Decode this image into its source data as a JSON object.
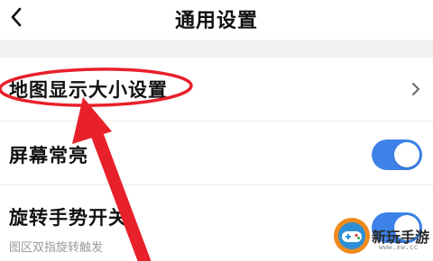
{
  "header": {
    "title": "通用设置",
    "back_icon": "chevron-left-icon"
  },
  "settings": [
    {
      "label": "地图显示大小设置",
      "type": "link",
      "icon": "chevron-right-icon"
    },
    {
      "label": "屏幕常亮",
      "type": "toggle",
      "on": true
    },
    {
      "label": "旋转手势开关",
      "sub": "图区双指旋转触发",
      "type": "toggle",
      "on": true
    }
  ],
  "colors": {
    "toggle_on": "#3d82e8",
    "annotation_red": "#e8202a",
    "section_gap": "#f2f2f2"
  },
  "watermark": {
    "text": "新玩手游",
    "url": "www.xw.cc",
    "icon": "gamepad-logo-icon"
  }
}
